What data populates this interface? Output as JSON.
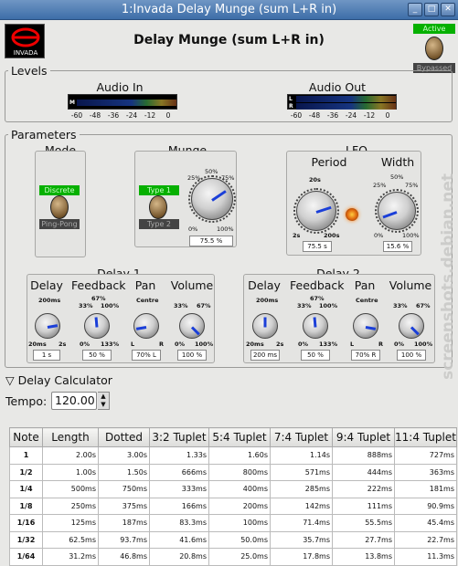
{
  "window": {
    "title": "1:Invada Delay Munge (sum L+R in)",
    "min_btn": "_",
    "max_btn": "□",
    "close_btn": "✕"
  },
  "header": {
    "title": "Delay Munge (sum L+R in)",
    "logo_text": "INVADA",
    "bypass_active": "Active",
    "bypass_bypassed": "Bypassed"
  },
  "levels": {
    "title": "Levels",
    "audio_in": {
      "label": "Audio In",
      "channel": "M",
      "scale": [
        "-60",
        "-48",
        "-36",
        "-24",
        "-12",
        "0"
      ]
    },
    "audio_out": {
      "label": "Audio Out",
      "channel_l": "L",
      "channel_r": "R",
      "scale": [
        "-60",
        "-48",
        "-36",
        "-24",
        "-12",
        "0"
      ]
    }
  },
  "parameters": {
    "title": "Parameters",
    "mode": {
      "title": "Mode",
      "opt1": "Discrete",
      "opt2": "Ping-Pong"
    },
    "munge": {
      "title": "Munge",
      "opt1": "Type 1",
      "opt2": "Type 2",
      "t0": "0%",
      "t25": "25%",
      "t50": "50%",
      "t75": "75%",
      "t100": "100%",
      "value": "75.5 %",
      "level": 0.755
    },
    "lfo": {
      "title": "LFO",
      "period": {
        "label": "Period",
        "t_min": "2s",
        "t_mid": "20s",
        "t_max": "200s",
        "value": "75.5 s"
      },
      "width": {
        "label": "Width",
        "t0": "0%",
        "t25": "25%",
        "t50": "50%",
        "t75": "75%",
        "t100": "100%",
        "value": "15.6 %"
      }
    },
    "delay1": {
      "title": "Delay 1",
      "delay": {
        "label": "Delay",
        "t_top": "200ms",
        "t_min": "20ms",
        "t_max": "2s",
        "value": "1 s"
      },
      "feedback": {
        "label": "Feedback",
        "t_top": "67%",
        "t_l": "33%",
        "t_r": "100%",
        "t_min": "0%",
        "t_max": "133%",
        "value": "50 %"
      },
      "pan": {
        "label": "Pan",
        "t_top": "Centre",
        "t_min": "L",
        "t_max": "R",
        "value": "70% L"
      },
      "volume": {
        "label": "Volume",
        "t_l": "33%",
        "t_r": "67%",
        "t_min": "0%",
        "t_max": "100%",
        "value": "100 %"
      }
    },
    "delay2": {
      "title": "Delay 2",
      "delay": {
        "label": "Delay",
        "t_top": "200ms",
        "t_min": "20ms",
        "t_max": "2s",
        "value": "200 ms"
      },
      "feedback": {
        "label": "Feedback",
        "t_top": "67%",
        "t_l": "33%",
        "t_r": "100%",
        "t_min": "0%",
        "t_max": "133%",
        "value": "50 %"
      },
      "pan": {
        "label": "Pan",
        "t_top": "Centre",
        "t_min": "L",
        "t_max": "R",
        "value": "70% R"
      },
      "volume": {
        "label": "Volume",
        "t_l": "33%",
        "t_r": "67%",
        "t_min": "0%",
        "t_max": "100%",
        "value": "100 %"
      }
    }
  },
  "calculator": {
    "title": "Delay Calculator",
    "tempo_label": "Tempo:",
    "tempo_value": "120.00",
    "columns": [
      "Note",
      "Length",
      "Dotted",
      "3:2 Tuplet",
      "5:4 Tuplet",
      "7:4 Tuplet",
      "9:4 Tuplet",
      "11:4 Tuplet"
    ],
    "rows": [
      [
        "1",
        "2.00s",
        "3.00s",
        "1.33s",
        "1.60s",
        "1.14s",
        "888ms",
        "727ms"
      ],
      [
        "1/2",
        "1.00s",
        "1.50s",
        "666ms",
        "800ms",
        "571ms",
        "444ms",
        "363ms"
      ],
      [
        "1/4",
        "500ms",
        "750ms",
        "333ms",
        "400ms",
        "285ms",
        "222ms",
        "181ms"
      ],
      [
        "1/8",
        "250ms",
        "375ms",
        "166ms",
        "200ms",
        "142ms",
        "111ms",
        "90.9ms"
      ],
      [
        "1/16",
        "125ms",
        "187ms",
        "83.3ms",
        "100ms",
        "71.4ms",
        "55.5ms",
        "45.4ms"
      ],
      [
        "1/32",
        "62.5ms",
        "93.7ms",
        "41.6ms",
        "50.0ms",
        "35.7ms",
        "27.7ms",
        "22.7ms"
      ],
      [
        "1/64",
        "31.2ms",
        "46.8ms",
        "20.8ms",
        "25.0ms",
        "17.8ms",
        "13.8ms",
        "11.3ms"
      ]
    ]
  },
  "watermark": "screenshots.debian.net",
  "colors": {
    "led_green": "#06b000",
    "knob_indicator": "#1b3fd8",
    "titlebar": "#4a78b0"
  }
}
